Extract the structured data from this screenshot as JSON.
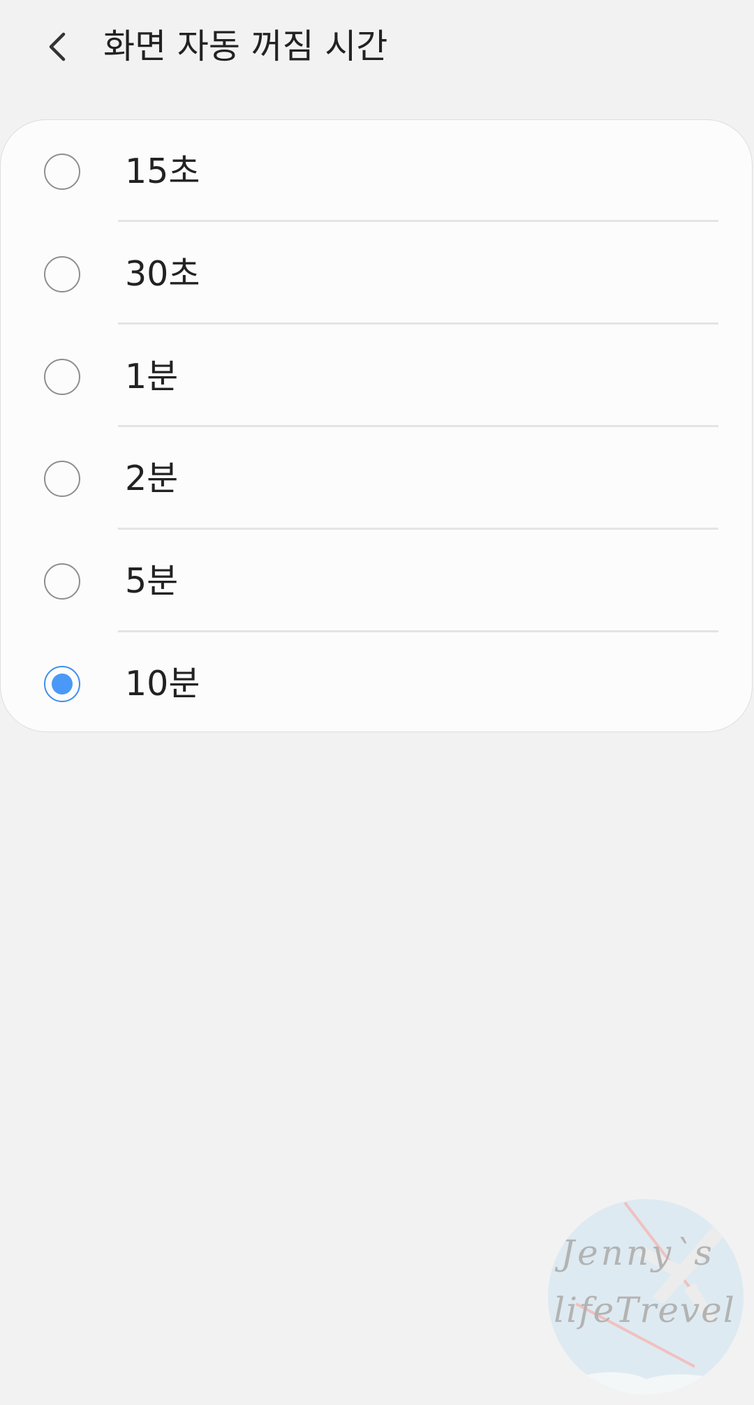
{
  "header": {
    "back_icon": "chevron-left-icon",
    "title": "화면 자동 꺼짐 시간"
  },
  "options": [
    {
      "label": "15초",
      "selected": false
    },
    {
      "label": "30초",
      "selected": false
    },
    {
      "label": "1분",
      "selected": false
    },
    {
      "label": "2분",
      "selected": false
    },
    {
      "label": "5분",
      "selected": false
    },
    {
      "label": "10분",
      "selected": true
    }
  ],
  "watermark": {
    "line1": "Jenny`s",
    "line2": "lifeTrevel"
  },
  "colors": {
    "background": "#f2f2f2",
    "card": "#fcfcfc",
    "accent": "#4a98f7",
    "text": "#222222",
    "radio_border": "#8e8e8e"
  }
}
